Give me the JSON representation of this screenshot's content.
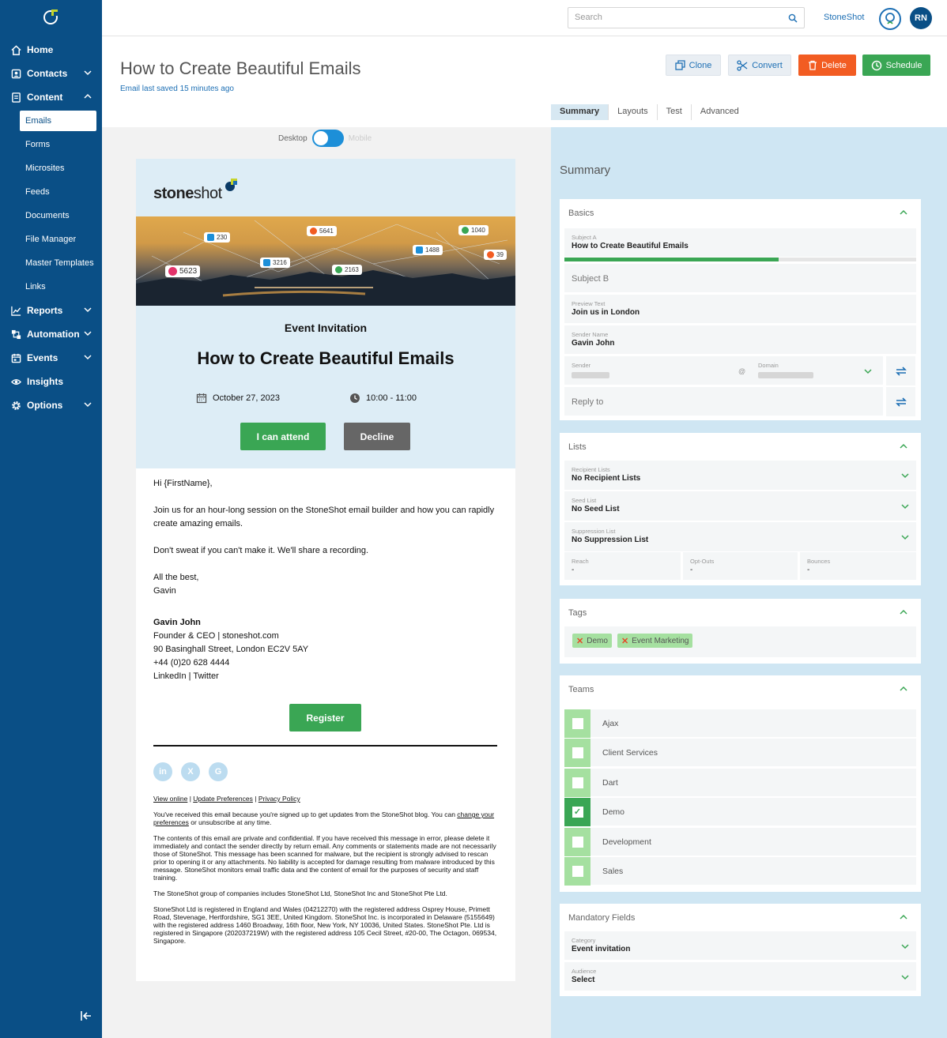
{
  "sidebar": {
    "items": [
      {
        "label": "Home",
        "icon": "home-icon",
        "has_chevron": false
      },
      {
        "label": "Contacts",
        "icon": "contacts-icon",
        "has_chevron": true
      },
      {
        "label": "Content",
        "icon": "content-icon",
        "has_chevron": true,
        "expanded": true
      }
    ],
    "content_sub": [
      "Emails",
      "Forms",
      "Microsites",
      "Feeds",
      "Documents",
      "File Manager",
      "Master Templates",
      "Links"
    ],
    "active_sub": "Emails",
    "more_items": [
      {
        "label": "Reports",
        "icon": "reports-icon"
      },
      {
        "label": "Automation",
        "icon": "automation-icon"
      },
      {
        "label": "Events",
        "icon": "events-icon"
      },
      {
        "label": "Insights",
        "icon": "insights-icon"
      },
      {
        "label": "Options",
        "icon": "options-icon"
      }
    ]
  },
  "topbar": {
    "search_placeholder": "Search",
    "brand_link": "StoneShot",
    "user_initials": "RN"
  },
  "header": {
    "title": "How to Create Beautiful Emails",
    "saved_note": "Email last saved 15 minutes ago",
    "buttons": {
      "clone": "Clone",
      "convert": "Convert",
      "delete": "Delete",
      "schedule": "Schedule"
    }
  },
  "tabs": [
    "Summary",
    "Layouts",
    "Test",
    "Advanced"
  ],
  "active_tab": "Summary",
  "preview": {
    "toggle_left": "Desktop",
    "toggle_right": "Mobile"
  },
  "email": {
    "logo_bold": "stone",
    "logo_light": "shot",
    "hero_badges": [
      "230",
      "5641",
      "1040",
      "1488",
      "3216",
      "2163",
      "5623",
      "39"
    ],
    "event_label": "Event Invitation",
    "event_title": "How to Create Beautiful Emails",
    "date": "October 27, 2023",
    "time": "10:00 - 11:00",
    "attend_label": "I can attend",
    "decline_label": "Decline",
    "greeting": "Hi {FirstName},",
    "para1": "Join us for an hour-long session on the StoneShot email builder and how you can rapidly create amazing emails.",
    "para2": "Don't sweat if you can't make it. We'll share a recording.",
    "signoff1": "All the best,",
    "signoff2": "Gavin",
    "sig_name": "Gavin John",
    "sig_role": "Founder & CEO | stoneshot.com",
    "sig_address": "90 Basinghall Street, London EC2V 5AY",
    "sig_phone": "+44 (0)20 628 4444",
    "sig_links": "LinkedIn | Twitter",
    "register_label": "Register",
    "footer_links": [
      "View online",
      "Update Preferences",
      "Privacy Policy"
    ],
    "footer_p1a": "You've received this email because you're signed up to get updates from the StoneShot blog. You can ",
    "footer_p1_link": "change your preferences",
    "footer_p1b": " or unsubscribe at any time.",
    "footer_p2": "The contents of this email are private and confidential. If you have received this message in error, please delete it immediately and contact the sender directly by return email. Any comments or statements made are not necessarily those of StoneShot. This message has been scanned for malware, but the recipient is strongly advised to rescan prior to opening it or any attachments. No liability is accepted for damage resulting from malware introduced by this message. StoneShot monitors email traffic data and the content of email for the purposes of security and staff training.",
    "footer_p3": "The StoneShot group of companies includes StoneShot Ltd, StoneShot Inc and StoneShot Pte Ltd.",
    "footer_p4": "StoneShot Ltd is registered in England and Wales (04212270) with the registered address Osprey House, Primett Road, Stevenage, Hertfordshire, SG1 3EE, United Kingdom. StoneShot Inc. is incorporated in Delaware (5155649) with the registered address 1460 Broadway, 16th floor, New York, NY 10036, United States. StoneShot Pte. Ltd is registered in Singapore (202037219W) with the registered address 105 Cecil Street, #20-00, The Octagon, 069534, Singapore."
  },
  "summary": {
    "title": "Summary",
    "basics": {
      "heading": "Basics",
      "subject_a_label": "Subject A",
      "subject_a": "How to Create Beautiful Emails",
      "subject_progress": 0.61,
      "subject_b_placeholder": "Subject B",
      "preview_label": "Preview Text",
      "preview": "Join us in London",
      "sender_name_label": "Sender Name",
      "sender_name": "Gavin John",
      "sender_label": "Sender",
      "at": "@",
      "domain_label": "Domain",
      "reply_to_placeholder": "Reply to"
    },
    "lists": {
      "heading": "Lists",
      "recipient_label": "Recipient Lists",
      "recipient": "No Recipient Lists",
      "seed_label": "Seed List",
      "seed": "No Seed List",
      "suppression_label": "Suppression List",
      "suppression": "No Suppression List",
      "reach_label": "Reach",
      "reach": "-",
      "optouts_label": "Opt-Outs",
      "optouts": "-",
      "bounces_label": "Bounces",
      "bounces": "-"
    },
    "tags": {
      "heading": "Tags",
      "items": [
        "Demo",
        "Event Marketing"
      ]
    },
    "teams": {
      "heading": "Teams",
      "items": [
        {
          "name": "Ajax",
          "checked": false
        },
        {
          "name": "Client Services",
          "checked": false
        },
        {
          "name": "Dart",
          "checked": false
        },
        {
          "name": "Demo",
          "checked": true
        },
        {
          "name": "Development",
          "checked": false
        },
        {
          "name": "Sales",
          "checked": false
        }
      ]
    },
    "mandatory": {
      "heading": "Mandatory Fields",
      "category_label": "Category",
      "category": "Event invitation",
      "audience_label": "Audience",
      "audience": "Select"
    }
  },
  "colors": {
    "sidebar": "#0a4f86",
    "accent_green": "#3aa654",
    "delete_orange": "#f25c22",
    "panel_blue": "#cfe6f3",
    "email_top": "#ddedf6"
  }
}
